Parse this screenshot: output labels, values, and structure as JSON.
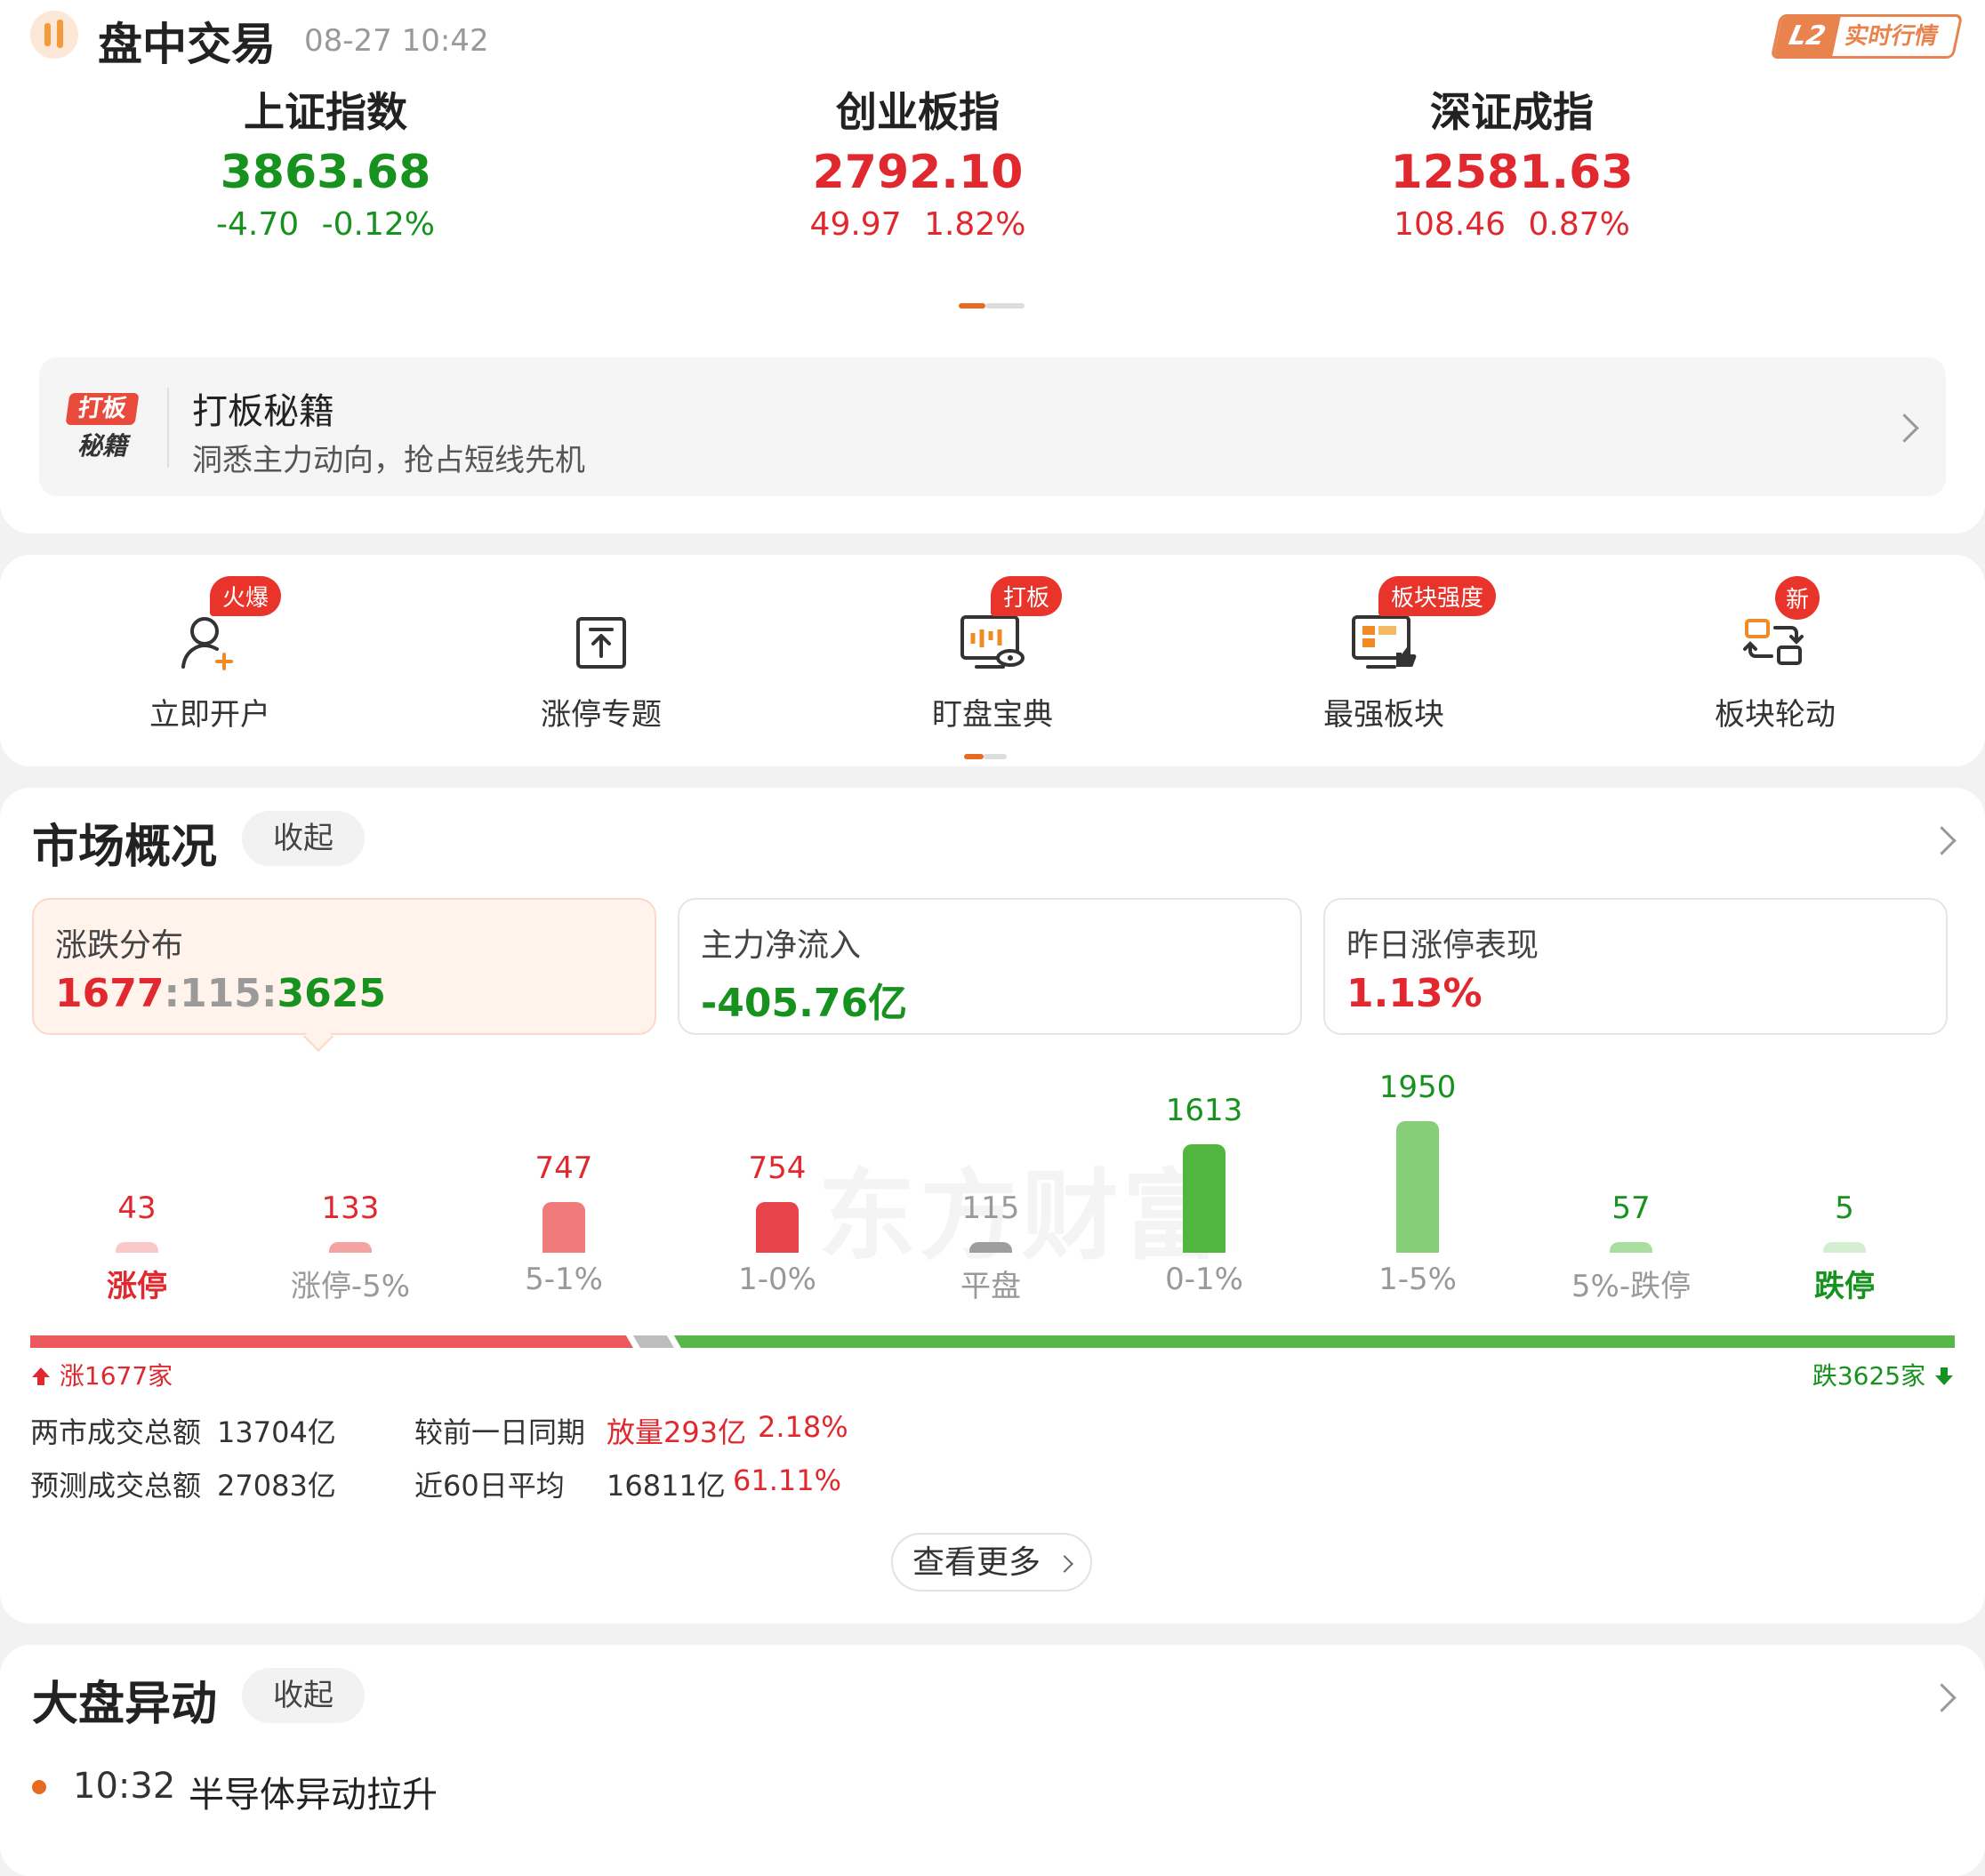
{
  "header": {
    "title": "盘中交易",
    "datetime": "08-27 10:42",
    "badge_l2": "L2",
    "badge_text": "实时行情"
  },
  "indices": [
    {
      "name": "上证指数",
      "value": "3863.68",
      "change": "-4.70",
      "change_pct": "-0.12%",
      "trend": "down"
    },
    {
      "name": "创业板指",
      "value": "2792.10",
      "change": "49.97",
      "change_pct": "1.82%",
      "trend": "up"
    },
    {
      "name": "深证成指",
      "value": "12581.63",
      "change": "108.46",
      "change_pct": "0.87%",
      "trend": "up"
    }
  ],
  "banner": {
    "icon_line1": "打板",
    "icon_line2": "秘籍",
    "title": "打板秘籍",
    "subtitle": "洞悉主力动向，抢占短线先机"
  },
  "nav": [
    {
      "label": "立即开户",
      "badge": "火爆",
      "icon": "user-add-icon"
    },
    {
      "label": "涨停专题",
      "badge": "",
      "icon": "upload-box-icon"
    },
    {
      "label": "盯盘宝典",
      "badge": "打板",
      "icon": "monitor-candlestick-icon"
    },
    {
      "label": "最强板块",
      "badge": "板块强度",
      "icon": "monitor-thumb-icon"
    },
    {
      "label": "板块轮动",
      "badge": "新",
      "icon": "rotate-arrows-icon"
    }
  ],
  "market": {
    "title": "市场概况",
    "collapse": "收起",
    "stats": [
      {
        "label": "涨跌分布",
        "value_up": "1677",
        "value_flat": "115",
        "value_down": "3625",
        "sep": ":"
      },
      {
        "label": "主力净流入",
        "value": "-405.76亿"
      },
      {
        "label": "昨日涨停表现",
        "value": "1.13%"
      }
    ],
    "watermark": "东方财富",
    "up_label": "涨1677家",
    "down_label": "跌3625家",
    "turnover": [
      {
        "label": "两市成交总额",
        "value": "13704亿",
        "compare_label": "较前一日同期",
        "compare_value": "放量293亿",
        "compare_pct": "2.18%"
      },
      {
        "label": "预测成交总额",
        "value": "27083亿",
        "compare_label": "近60日平均",
        "compare_value": "16811亿",
        "compare_pct": "61.11%"
      }
    ],
    "more": "查看更多"
  },
  "chart_data": {
    "type": "bar",
    "categories": [
      "涨停",
      "涨停-5%",
      "5-1%",
      "1-0%",
      "平盘",
      "0-1%",
      "1-5%",
      "5%-跌停",
      "跌停"
    ],
    "values": [
      43,
      133,
      747,
      754,
      115,
      1613,
      1950,
      57,
      5
    ],
    "colors": [
      "#f8c9c8",
      "#f4a3a3",
      "#f07b7b",
      "#e8424a",
      "#9e9e9e",
      "#52b540",
      "#86cf78",
      "#a9dea0",
      "#d4eed0"
    ],
    "label_colors": [
      "#e0282e",
      "#e0282e",
      "#e0282e",
      "#e0282e",
      "#9a9a9a",
      "#17921f",
      "#17921f",
      "#17921f",
      "#17921f"
    ],
    "up_count": 1677,
    "flat_count": 115,
    "down_count": 3625
  },
  "movers": {
    "title": "大盘异动",
    "collapse": "收起",
    "items": [
      {
        "time": "10:32",
        "text": "半导体异动拉升"
      }
    ]
  }
}
